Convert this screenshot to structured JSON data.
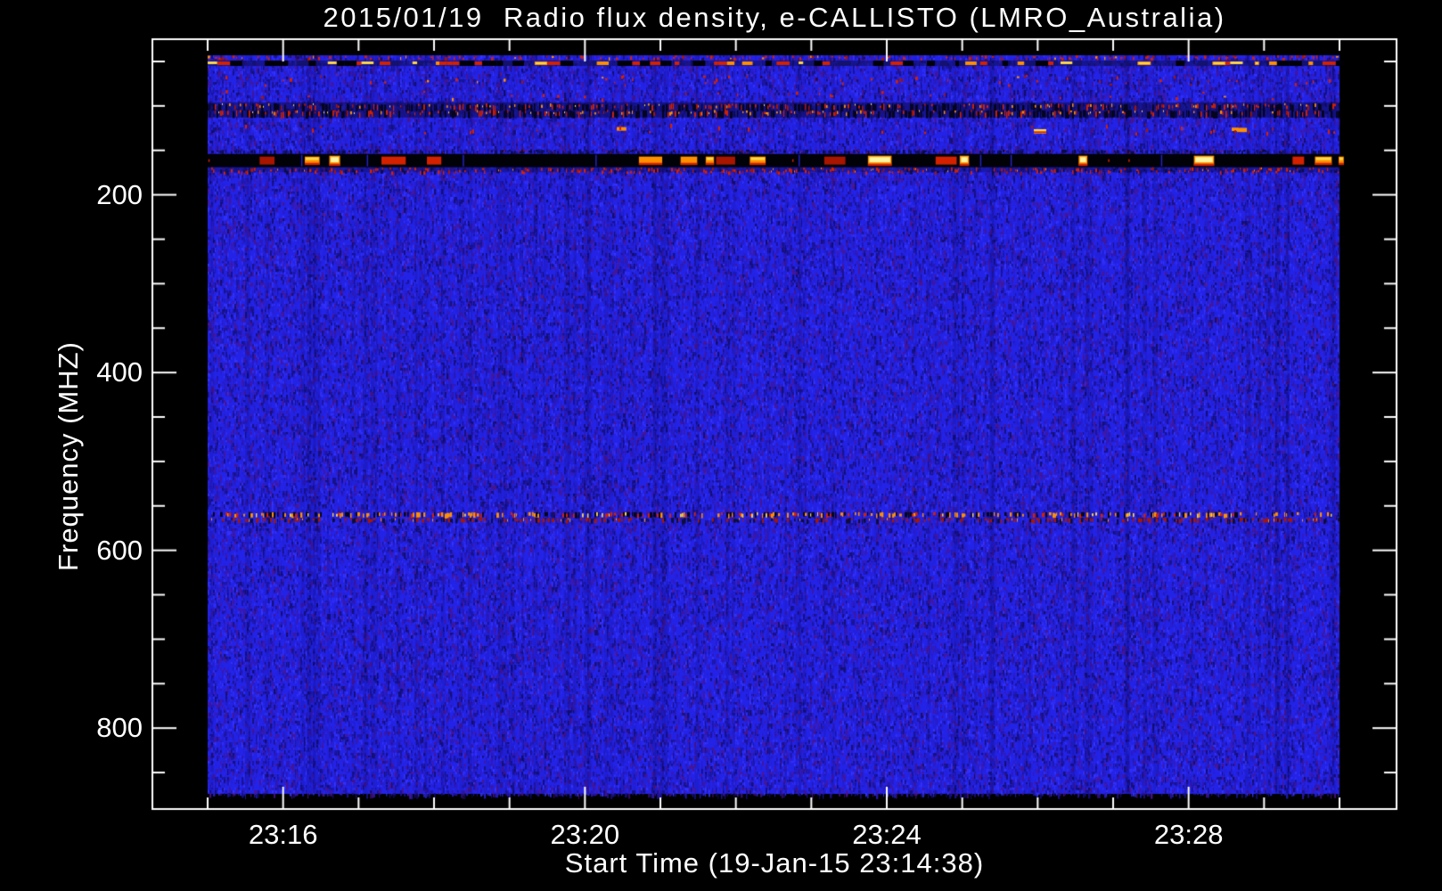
{
  "page": {
    "background": "#000000"
  },
  "chart_data": {
    "type": "heatmap",
    "subtype": "radio-spectrogram",
    "title": "2015/01/19  Radio flux density, e-CALLISTO (LMRO_Australia)",
    "xlabel": "Start Time (19-Jan-15 23:14:38)",
    "ylabel": "Frequency (MHZ)",
    "instrument": "e-CALLISTO",
    "station": "LMRO_Australia",
    "date": "2015/01/19",
    "start_time": "23:14:38",
    "x_axis": {
      "tick_labels": [
        "23:16",
        "23:20",
        "23:24",
        "23:28"
      ],
      "tick_minutes_from_2315": [
        1,
        5,
        9,
        13
      ],
      "minor_tick_every_min": 1,
      "span_minutes_from_2315": [
        0,
        15
      ]
    },
    "y_axis": {
      "tick_labels": [
        "200",
        "400",
        "600",
        "800"
      ],
      "tick_values_mhz": [
        200,
        400,
        600,
        800
      ],
      "minor_tick_every_mhz": 50,
      "range_mhz": [
        43,
        874
      ],
      "inverted": true
    },
    "legend": "none",
    "grid": false,
    "colors": {
      "background": "#000000",
      "frame": "#ffffff",
      "text": "#ffffff",
      "base_blue": "#2323e8",
      "noise_dark": [
        "#1b1292",
        "#2c18b4",
        "#2420d0",
        "#140e6e",
        "#4a148c"
      ],
      "noise_bright": "#3535ff",
      "band_black": "#010108",
      "dark_navy": "#0c0c42",
      "red": "#d42200",
      "dark_red": "#a81600",
      "orange": "#ff9000",
      "yellow": "#ffd848",
      "pale_yellow": "#fff4a0"
    },
    "rfi_bands": [
      {
        "name": "speckle-45mhz",
        "freq_mhz": [
          43,
          48
        ],
        "style": "speckle",
        "density": 0.28
      },
      {
        "name": "burst-line-52mhz",
        "freq_mhz": [
          48,
          56
        ],
        "style": "burst-line"
      },
      {
        "name": "speckle-70mhz",
        "freq_mhz": [
          65,
          78
        ],
        "style": "speckle",
        "density": 0.1
      },
      {
        "name": "speckle-88mhz",
        "freq_mhz": [
          82,
          94
        ],
        "style": "speckle",
        "density": 0.06
      },
      {
        "name": "dense-band-105mhz",
        "freq_mhz": [
          96,
          113
        ],
        "style": "dense-band"
      },
      {
        "name": "scatter-126mhz",
        "freq_mhz": [
          118,
          134
        ],
        "style": "scatter-bursts"
      },
      {
        "name": "dark-row-151mhz",
        "freq_mhz": [
          149,
          154
        ],
        "style": "dark-speckle"
      },
      {
        "name": "saturated-band-160mhz",
        "freq_mhz": [
          154,
          169
        ],
        "style": "saturated-band"
      },
      {
        "name": "red-row-172mhz",
        "freq_mhz": [
          169,
          177
        ],
        "style": "red-speckle"
      },
      {
        "name": "dash-band-563mhz",
        "freq_mhz": [
          556,
          571
        ],
        "style": "orange-dash-band"
      }
    ]
  }
}
